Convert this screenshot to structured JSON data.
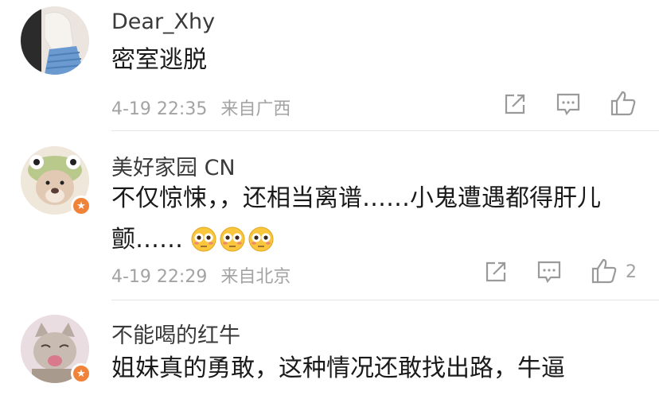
{
  "comments": [
    {
      "username": "Dear_Xhy",
      "text": "密室逃脱",
      "time": "4-19 22:35",
      "location": "来自广西",
      "likes": "",
      "verified": false,
      "avatar_icon": "hand-sweater-avatar-photo"
    },
    {
      "username": "美好家园 CN",
      "text_line1": "不仅惊悚，，还相当离谱……小鬼遭遇都得肝儿",
      "text_line2": "颤……",
      "time": "4-19 22:29",
      "location": "来自北京",
      "likes": "2",
      "verified": true,
      "emojis": [
        "flushed-face-emoji",
        "flushed-face-emoji",
        "flushed-face-emoji"
      ],
      "avatar_icon": "dog-with-frog-hat-avatar-photo"
    },
    {
      "username": "不能喝的红牛",
      "text": "姐妹真的勇敢，这种情况还敢找出路，牛逼",
      "verified": true,
      "avatar_icon": "crying-cat-avatar-photo"
    }
  ],
  "icons": {
    "share": "share-icon",
    "comment": "comment-icon",
    "like": "thumbs-up-icon",
    "badge": "verified-badge-icon"
  },
  "colors": {
    "badge": "#f0833a",
    "meta_text": "#a3a3a3",
    "body_text": "#1a1a1a"
  }
}
